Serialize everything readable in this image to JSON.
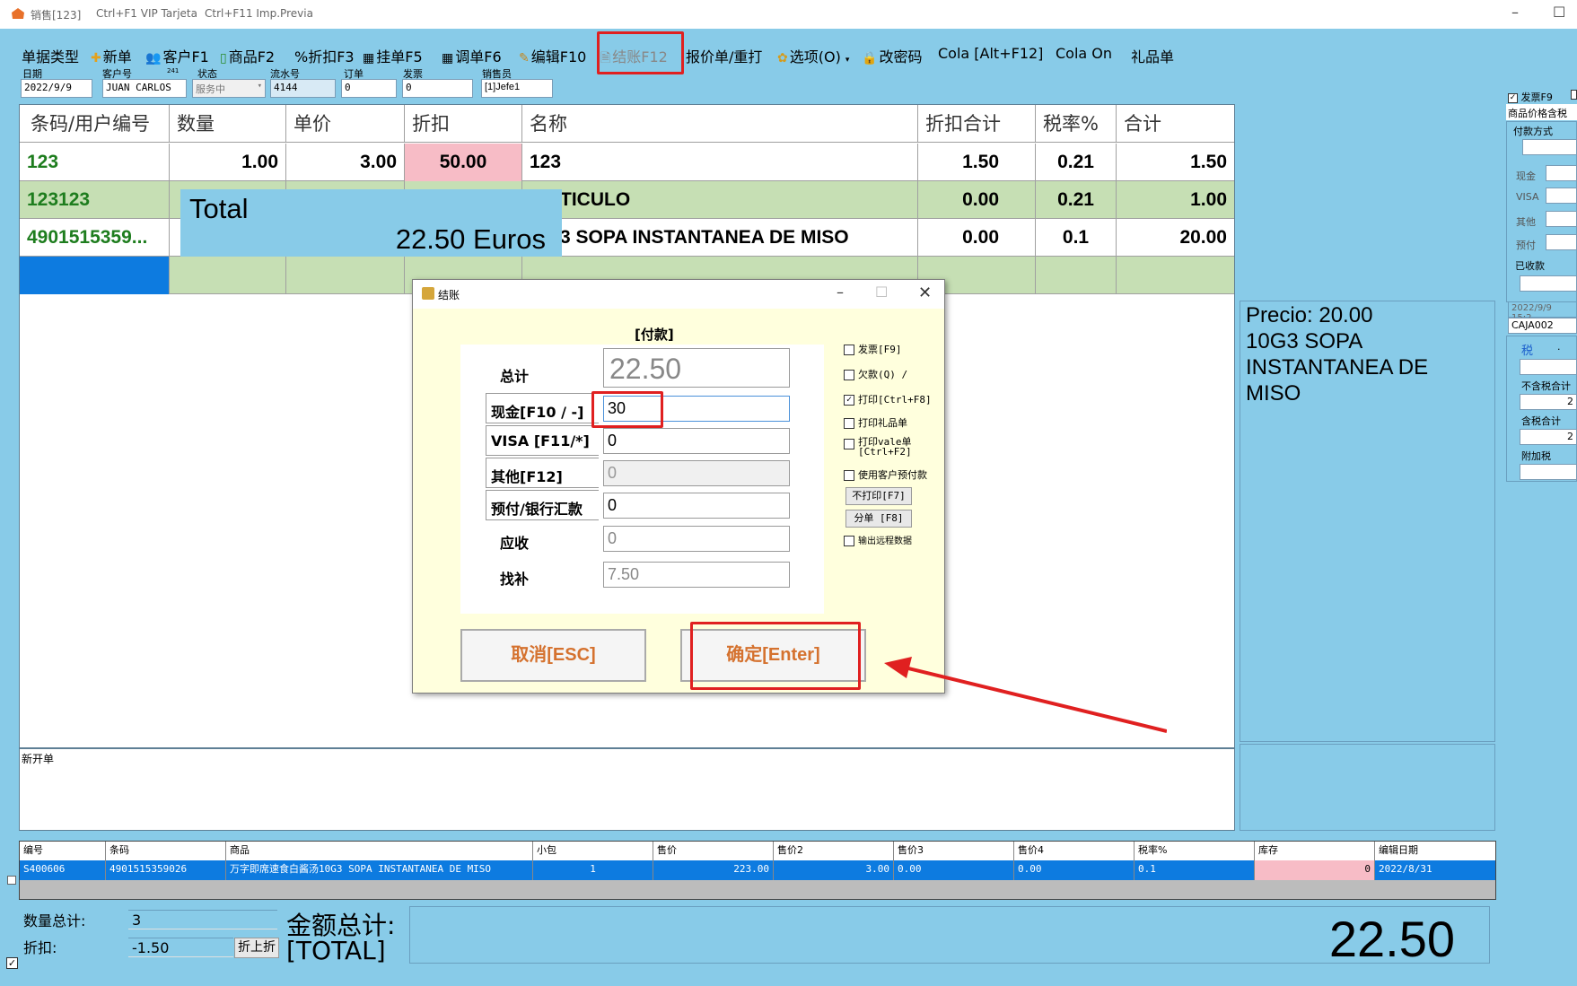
{
  "titlebar": {
    "title": "销售[123]",
    "hint1": "Ctrl+F1 VIP Tarjeta",
    "hint2": "Ctrl+F11 Imp.Previa",
    "min": "–",
    "max": "☐"
  },
  "toolbar": {
    "items": [
      {
        "label": "单据类型",
        "icon": ""
      },
      {
        "label": "新单",
        "icon": "✚"
      },
      {
        "label": "客户F1",
        "icon": "👥"
      },
      {
        "label": "商品F2",
        "icon": "▯"
      },
      {
        "label": "%折扣F3",
        "icon": ""
      },
      {
        "label": "挂单F5",
        "icon": "▦"
      },
      {
        "label": "调单F6",
        "icon": "▦"
      },
      {
        "label": "编辑F10",
        "icon": "✎"
      },
      {
        "label": "结账F12",
        "icon": "🗎"
      },
      {
        "label": "报价单/重打",
        "icon": ""
      },
      {
        "label": "选项(O)",
        "icon": "✿"
      },
      {
        "label": "改密码",
        "icon": "🔒"
      },
      {
        "label": "Cola [Alt+F12]",
        "icon": ""
      },
      {
        "label": "Cola On",
        "icon": ""
      },
      {
        "label": "礼品单",
        "icon": ""
      }
    ]
  },
  "header": {
    "date_label": "日期",
    "date": "2022/9/9",
    "customer_label": "客户号",
    "customer_id": "241",
    "customer": "JUAN CARLOS",
    "status_label": "状态",
    "status": "服务中",
    "serial_label": "流水号",
    "serial": "4144",
    "order_label": "订单",
    "order": "0",
    "invoice_label": "发票",
    "invoice": "0",
    "seller_label": "销售员",
    "seller": "[1]Jefe1"
  },
  "table": {
    "headers": [
      "条码/用户编号",
      "数量",
      "单价",
      "折扣",
      "名称",
      "折扣合计",
      "税率%",
      "合计"
    ],
    "rows": [
      [
        "123",
        "1.00",
        "3.00",
        "50.00",
        "123",
        "1.50",
        "0.21",
        "1.50"
      ],
      [
        "123123",
        "",
        "",
        "",
        "TICULO",
        "0.00",
        "0.21",
        "1.00"
      ],
      [
        "4901515359...",
        "",
        "",
        "",
        "3 SOPA INSTANTANEA DE MISO",
        "0.00",
        "0.1",
        "20.00"
      ]
    ]
  },
  "total_overlay": {
    "label": "Total",
    "value": "22.50 Euros"
  },
  "dialog": {
    "title": "结账",
    "header": "[付款]",
    "total_label": "总计",
    "total": "22.50",
    "cash_label": "现金[F10 / -]",
    "cash": "30",
    "visa_label": "VISA [F11/*]",
    "visa": "0",
    "other_label": "其他[F12]",
    "other": "0",
    "prepaid_label": "预付/银行汇款",
    "prepaid": "0",
    "receivable_label": "应收",
    "receivable": "0",
    "change_label": "找补",
    "change": "7.50",
    "options": [
      {
        "label": "发票[F9]",
        "checked": false
      },
      {
        "label": "欠款(Q) /",
        "checked": false
      },
      {
        "label": "打印[Ctrl+F8]",
        "checked": true
      },
      {
        "label": "打印礼品单",
        "checked": false
      },
      {
        "label": "打印vale单 [Ctrl+F2]",
        "checked": false
      },
      {
        "label": "使用客户预付款",
        "checked": false
      }
    ],
    "noprint_btn": "不打印[F7]",
    "split_btn": "分单 [F8]",
    "export_label": "输出远程数据",
    "cancel_btn": "取消[ESC]",
    "confirm_btn": "确定[Enter]"
  },
  "info": {
    "price": "Precio: 20.00",
    "name": "10G3 SOPA INSTANTANEA DE MISO"
  },
  "sidebar": {
    "invoice_chk": "发票F9",
    "tax_incl": "商品价格含税",
    "payment": "付款方式",
    "cash": "现金",
    "visa": "VISA",
    "other": "其他",
    "prepaid": "预付",
    "received": "已收款",
    "datetime": "2022/9/9 15:2",
    "caja": "CAJA002",
    "tax": "税",
    "dot": ".",
    "no_tax_total": "不含税合计",
    "no_tax_total_val": "2",
    "tax_total": "含税合计",
    "tax_total_val": "2",
    "surcharge": "附加税"
  },
  "memo": {
    "text": "新开单"
  },
  "bottom_grid": {
    "headers": [
      "编号",
      "条码",
      "商品",
      "小包",
      "售价",
      "售价2",
      "售价3",
      "售价4",
      "税率%",
      "库存",
      "编辑日期"
    ],
    "row": [
      "S400606",
      "4901515359026",
      "万字即席速食白酱汤10G3 SOPA INSTANTANEA DE MISO",
      "1",
      "223.00",
      "3.00",
      "0.00",
      "0.00",
      "0.1",
      "0",
      "2022/8/31"
    ]
  },
  "footer": {
    "qty_label": "数量总计:",
    "qty": "3",
    "discount_label": "折扣:",
    "discount": "-1.50",
    "disc_btn": "折上折",
    "amount_label": "金额总计:",
    "amount_token": "[TOTAL]",
    "grand_total": "22.50"
  }
}
